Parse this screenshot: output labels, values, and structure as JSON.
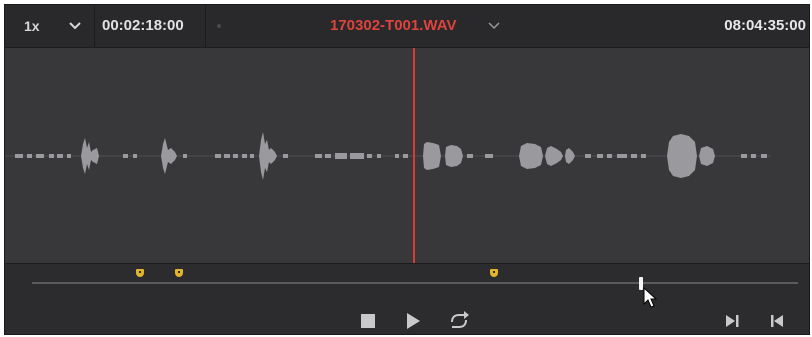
{
  "header": {
    "speed": "1x",
    "speed_dropdown_icon": "chevron-down-icon",
    "source_timecode": "00:02:18:00",
    "clip_name": "170302-T001.WAV",
    "clip_dropdown_icon": "chevron-down-icon",
    "record_timecode": "08:04:35:00"
  },
  "colors": {
    "clip_name": "#e0423c",
    "playhead": "#d63b35",
    "marker": "#e2b42a",
    "background": "#2e2e31"
  },
  "waveform": {
    "icon": "audio-waveform",
    "playhead_position_fraction": 0.505
  },
  "scrubber": {
    "marker_count": 3,
    "marker_icon": "marker-icon",
    "playhead_position_fraction": 0.795
  },
  "transport": {
    "stop_icon": "stop-icon",
    "play_icon": "play-icon",
    "loop_icon": "loop-icon",
    "next_frame_icon": "skip-to-end-icon",
    "prev_frame_icon": "skip-to-start-icon"
  }
}
